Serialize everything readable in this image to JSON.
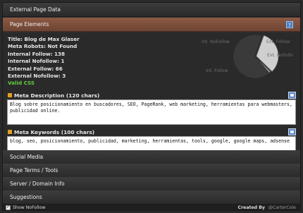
{
  "panel_title": "External Page Data",
  "sections": {
    "page_elements": "Page Elements",
    "social_media": "Social Media",
    "page_terms": "Page Terms / Tools",
    "server_domain": "Server / Domain Info",
    "suggestions": "Suggestions"
  },
  "help_label": "?",
  "stats": {
    "title": "Title: Blog de Max Glaser",
    "meta_robots": "Meta Robots: Not Found",
    "internal_follow": "Internal Follow: 138",
    "internal_nofollow": "Internal Nofollow: 1",
    "external_follow": "External Follow: 66",
    "external_nofollow": "External Nofollow: 3",
    "valid_css": "Valid CSS"
  },
  "pie": {
    "labels": {
      "int_nofollow": "Int. NoFollow",
      "ext_follow": "Ext. Follow",
      "ext_nofollow": "Ext. NoFollo",
      "int_follow": "Int. Follow"
    },
    "values": {
      "int_follow": 138,
      "int_nofollow": 1,
      "ext_follow": 66,
      "ext_nofollow": 3
    },
    "colors": {
      "int_follow": "#3a3a3a",
      "ext_follow": "#cfcfcf",
      "ext_nofollow": "#9a9a9a",
      "int_nofollow": "#555555"
    }
  },
  "meta_description": {
    "heading": "Meta Description (120 chars)",
    "text": "Blog sobre posicionamiento en buscadores, SEO, PageRank, web marketing, herramientas para webmasters, publicidad online."
  },
  "meta_keywords": {
    "heading": "Meta Keywords (100 chars)",
    "text": "blog, seo, posicionamiento, publicidad, marketing, herramientas, tools, google, google maps, adsense"
  },
  "footer": {
    "show_nofollow": "Show NoFollow",
    "created_by": "Created By",
    "author": "@CarterCole"
  }
}
